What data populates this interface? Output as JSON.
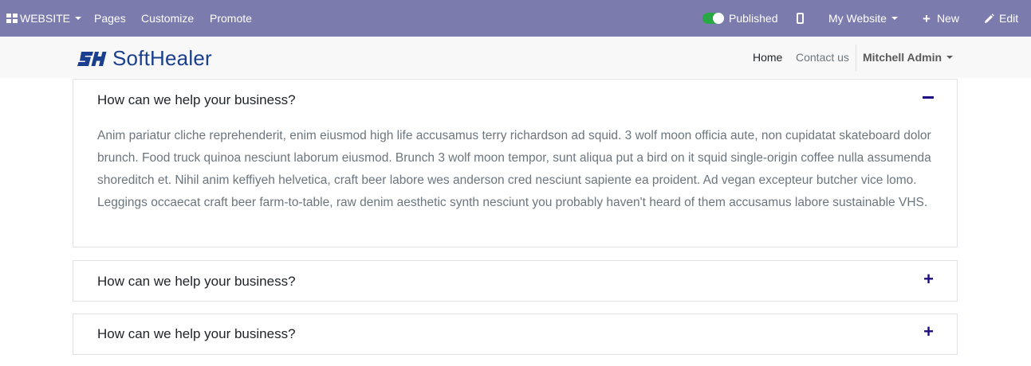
{
  "topbar": {
    "website_menu": "WEBSITE",
    "pages": "Pages",
    "customize": "Customize",
    "promote": "Promote",
    "published": "Published",
    "my_website": "My Website",
    "new": "New",
    "edit": "Edit",
    "background": "#7c7bad",
    "toggle_color": "#28a745"
  },
  "header": {
    "logo_text": "SoftHealer",
    "nav": {
      "home": "Home",
      "contact": "Contact us",
      "user": "Mitchell Admin"
    }
  },
  "accordion": {
    "accent": "#1d0a85",
    "items": [
      {
        "question": "How can we help your business?",
        "expanded": true,
        "answer": "Anim pariatur cliche reprehenderit, enim eiusmod high life accusamus terry richardson ad squid. 3 wolf moon officia aute, non cupidatat skateboard dolor brunch. Food truck quinoa nesciunt laborum eiusmod. Brunch 3 wolf moon tempor, sunt aliqua put a bird on it squid single-origin coffee nulla assumenda shoreditch et. Nihil anim keffiyeh helvetica, craft beer labore wes anderson cred nesciunt sapiente ea proident. Ad vegan excepteur butcher vice lomo. Leggings occaecat craft beer farm-to-table, raw denim aesthetic synth nesciunt you probably haven't heard of them accusamus labore sustainable VHS."
      },
      {
        "question": "How can we help your business?",
        "expanded": false
      },
      {
        "question": "How can we help your business?",
        "expanded": false
      }
    ]
  }
}
